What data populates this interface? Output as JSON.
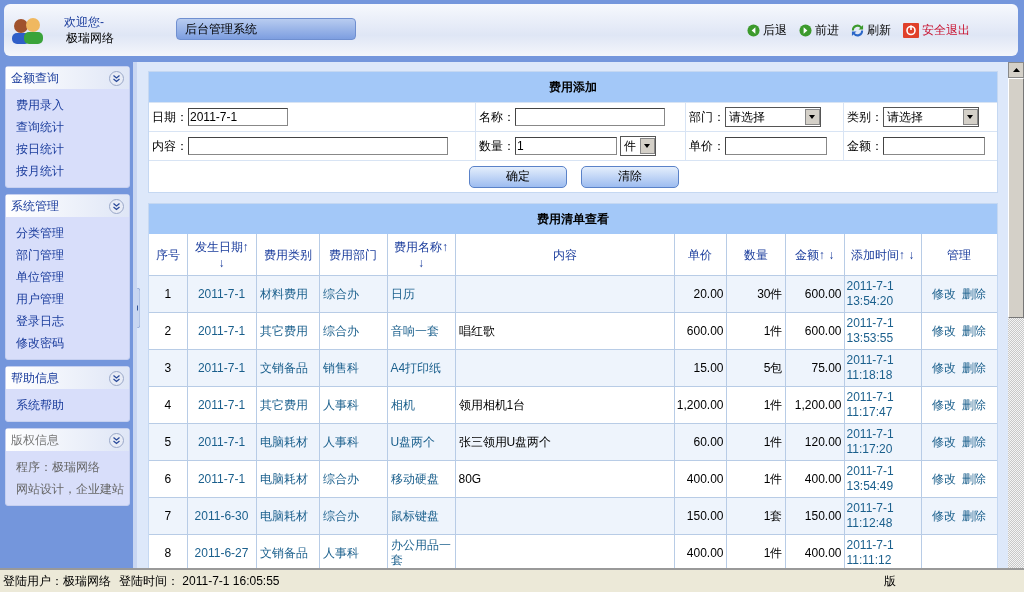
{
  "header": {
    "welcome": "欢迎您-",
    "user": "极瑞网络",
    "system_tab": "后台管理系统",
    "nav": [
      {
        "kind": "back",
        "label": "后退"
      },
      {
        "kind": "forward",
        "label": "前进"
      },
      {
        "kind": "refresh",
        "label": "刷新"
      },
      {
        "kind": "logout",
        "label": "安全退出"
      }
    ]
  },
  "sidebar": [
    {
      "title": "金额查询",
      "kind": "links",
      "items": [
        "费用录入",
        "查询统计",
        "按日统计",
        "按月统计"
      ]
    },
    {
      "title": "系统管理",
      "kind": "links",
      "items": [
        "分类管理",
        "部门管理",
        "单位管理",
        "用户管理",
        "登录日志",
        "修改密码"
      ]
    },
    {
      "title": "帮助信息",
      "kind": "links",
      "items": [
        "系统帮助"
      ]
    },
    {
      "title": "版权信息",
      "kind": "info",
      "items": [
        "程序：极瑞网络",
        "网站设计，企业建站"
      ]
    }
  ],
  "form": {
    "title": "费用添加",
    "date_label": "日期：",
    "date_value": "2011-7-1",
    "name_label": "名称：",
    "dept_label": "部门：",
    "dept_value": "请选择",
    "category_label": "类别：",
    "category_value": "请选择",
    "content_label": "内容：",
    "qty_label": "数量：",
    "qty_value": "1",
    "unit_value": "件",
    "price_label": "单价：",
    "amount_label": "金额：",
    "buttons": [
      "确定",
      "清除"
    ]
  },
  "table": {
    "title": "费用清单查看",
    "columns": [
      "序号",
      "发生日期↑ ↓",
      "费用类别",
      "费用部门",
      "费用名称↑ ↓",
      "内容",
      "单价",
      "数量",
      "金额↑ ↓",
      "添加时间↑ ↓",
      "管理"
    ],
    "rows": [
      {
        "no": "1",
        "date": "2011-7-1",
        "category": "材料费用",
        "dept": "综合办",
        "name": "日历",
        "content": "",
        "price": "20.00",
        "qty": "30件",
        "amount": "600.00",
        "added": [
          "2011-7-1",
          "13:54:20"
        ],
        "actions": [
          "修改",
          "删除"
        ]
      },
      {
        "no": "2",
        "date": "2011-7-1",
        "category": "其它费用",
        "dept": "综合办",
        "name": "音响一套",
        "content": "唱红歌",
        "price": "600.00",
        "qty": "1件",
        "amount": "600.00",
        "added": [
          "2011-7-1",
          "13:53:55"
        ],
        "actions": [
          "修改",
          "删除"
        ]
      },
      {
        "no": "3",
        "date": "2011-7-1",
        "category": "文销备品",
        "dept": "销售科",
        "name": "A4打印纸",
        "content": "",
        "price": "15.00",
        "qty": "5包",
        "amount": "75.00",
        "added": [
          "2011-7-1",
          "11:18:18"
        ],
        "actions": [
          "修改",
          "删除"
        ]
      },
      {
        "no": "4",
        "date": "2011-7-1",
        "category": "其它费用",
        "dept": "人事科",
        "name": "相机",
        "content": "领用相机1台",
        "price": "1,200.00",
        "qty": "1件",
        "amount": "1,200.00",
        "added": [
          "2011-7-1",
          "11:17:47"
        ],
        "actions": [
          "修改",
          "删除"
        ]
      },
      {
        "no": "5",
        "date": "2011-7-1",
        "category": "电脑耗材",
        "dept": "人事科",
        "name": "U盘两个",
        "content": "张三领用U盘两个",
        "price": "60.00",
        "qty": "1件",
        "amount": "120.00",
        "added": [
          "2011-7-1",
          "11:17:20"
        ],
        "actions": [
          "修改",
          "删除"
        ]
      },
      {
        "no": "6",
        "date": "2011-7-1",
        "category": "电脑耗材",
        "dept": "综合办",
        "name": "移动硬盘",
        "content": "80G",
        "price": "400.00",
        "qty": "1件",
        "amount": "400.00",
        "added": [
          "2011-7-1",
          "13:54:49"
        ],
        "actions": [
          "修改",
          "删除"
        ]
      },
      {
        "no": "7",
        "date": "2011-6-30",
        "category": "电脑耗材",
        "dept": "综合办",
        "name": "鼠标键盘",
        "content": "",
        "price": "150.00",
        "qty": "1套",
        "amount": "150.00",
        "added": [
          "2011-7-1",
          "11:12:48"
        ],
        "actions": [
          "修改",
          "删除"
        ]
      },
      {
        "no": "8",
        "date": "2011-6-27",
        "category": "文销备品",
        "dept": "人事科",
        "name": "办公用品一套",
        "content": "",
        "price": "400.00",
        "qty": "1件",
        "amount": "400.00",
        "added": [
          "2011-7-1",
          "11:11:12"
        ],
        "actions": []
      }
    ]
  },
  "status_bar": {
    "user_label": "登陆用户：",
    "user": "极瑞网络",
    "time_label": "登陆时间：",
    "time": "2011-7-1 16:05:55",
    "right": "版"
  }
}
